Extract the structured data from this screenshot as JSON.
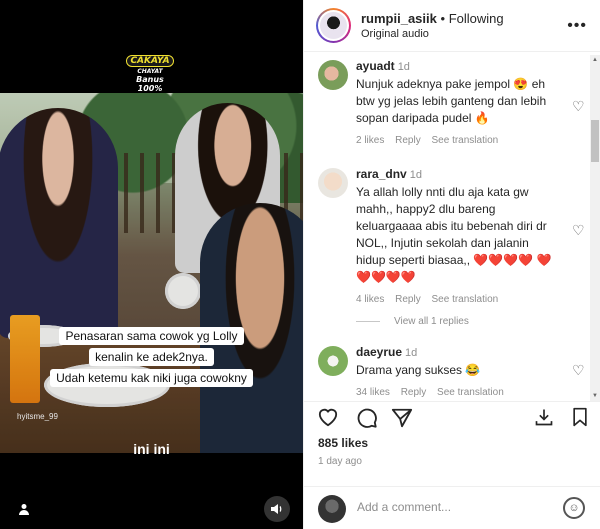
{
  "video": {
    "logo": {
      "top": "CAKAYA",
      "mid": "CHAYAT",
      "bottom_line1": "Banus",
      "bottom_line2": "100%"
    },
    "caption_lines": [
      "Penasaran sama cowok yg Lolly",
      "kenalin ke adek2nya.",
      "Udah ketemu kak niki juga cowokny"
    ],
    "watermark": "hyitsme_99",
    "subtitle": "ini ini"
  },
  "header": {
    "username": "rumpii_asiik",
    "separator": "•",
    "follow_status": "Following",
    "audio": "Original audio",
    "more_icon": "more-horizontal-icon"
  },
  "comments": [
    {
      "user": "ayuadt",
      "time": "1d",
      "text": "Nunjuk adeknya pake jempol 😍 eh btw yg jelas lebih ganteng dan lebih sopan daripada pudel 🔥",
      "likes": "2 likes",
      "reply": "Reply",
      "translate": "See translation"
    },
    {
      "user": "rara_dnv",
      "time": "1d",
      "text": "Ya allah lolly nnti dlu aja kata gw mahh,, happy2 dlu bareng keluargaaaa abis itu bebenah diri dr NOL,, Injutin sekolah dan jalanin hidup seperti biasaa,, ❤️❤️❤️❤️ ❤️❤️❤️❤️❤️",
      "likes": "4 likes",
      "reply": "Reply",
      "translate": "See translation"
    },
    {
      "user": "daeyrue",
      "time": "1d",
      "text": "Drama yang sukses 😂",
      "likes": "34 likes",
      "reply": "Reply",
      "translate": "See translation"
    }
  ],
  "view_replies": "View all 1 replies",
  "actions": {
    "likes": "885 likes",
    "posted": "1 day ago"
  },
  "add_comment": {
    "placeholder": "Add a comment..."
  }
}
